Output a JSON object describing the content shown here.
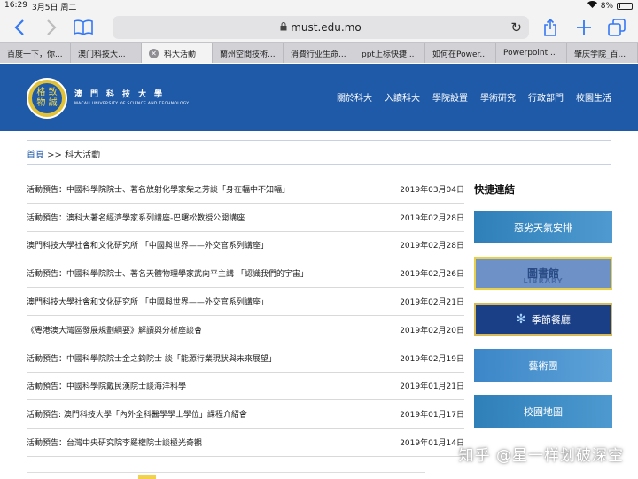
{
  "status": {
    "time": "16:29",
    "date": "3月5日 周二",
    "battery": "8%"
  },
  "browser": {
    "url": "must.edu.mo",
    "tabs": [
      {
        "label": "百度一下，你..."
      },
      {
        "label": "澳门科技大..."
      },
      {
        "label": "科大活動"
      },
      {
        "label": "蘭州空間技術..."
      },
      {
        "label": "消費行业生命..."
      },
      {
        "label": "ppt上标快捷..."
      },
      {
        "label": "如何在Power..."
      },
      {
        "label": "Powerpoint..."
      },
      {
        "label": "肇庆学院_百..."
      }
    ]
  },
  "site": {
    "seal_text": "格 致\n物 誠",
    "cn_name": "澳門科技大學",
    "en_name": "MACAU UNIVERSITY OF SCIENCE AND TECHNOLOGY",
    "nav": [
      "關於科大",
      "入讀科大",
      "學院設置",
      "學術研究",
      "行政部門",
      "校園生活"
    ]
  },
  "breadcrumb": {
    "home": "首頁",
    "sep": " >> ",
    "current": "科大活動"
  },
  "news": [
    {
      "title": "活動預告：中國科學院院士、著名放射化學家柴之芳談「身在輻中不知輻」",
      "date": "2019年03月04日"
    },
    {
      "title": "活動預告：澳科大著名經濟學家系列講座-巴曙松教授公開講座",
      "date": "2019年02月28日"
    },
    {
      "title": "澳門科技大學社會和文化研究所 「中國與世界——外交官系列講座」",
      "date": "2019年02月28日"
    },
    {
      "title": "活動預告：中國科學院院士、著名天體物理學家武向平主講 「認識我們的宇宙」",
      "date": "2019年02月26日"
    },
    {
      "title": "澳門科技大學社會和文化研究所 「中國與世界——外交官系列講座」",
      "date": "2019年02月21日"
    },
    {
      "title": "《粵港澳大灣區發展規劃綱要》解讀與分析座談會",
      "date": "2019年02月20日"
    },
    {
      "title": "活動預告：中國科學院院士金之鈞院士 談「能源行業現狀與未來展望」",
      "date": "2019年02月19日"
    },
    {
      "title": "活動預告：中國科學院戴民漢院士談海洋科學",
      "date": "2019年01月21日"
    },
    {
      "title": "活動預告: 澳門科技大學「內外全科醫學學士學位」課程介紹會",
      "date": "2019年01月17日"
    },
    {
      "title": "活動預告：台灣中央研究院李羅權院士談極光奇觀",
      "date": "2019年01月14日"
    }
  ],
  "quick_links": {
    "title": "快捷連結",
    "items": [
      "惡劣天氣安排",
      "圖書館",
      "季節餐廳",
      "藝術團",
      "校園地圖"
    ],
    "library_en": "LIBRARY"
  },
  "watermark": "知乎 @星一样划破深空"
}
